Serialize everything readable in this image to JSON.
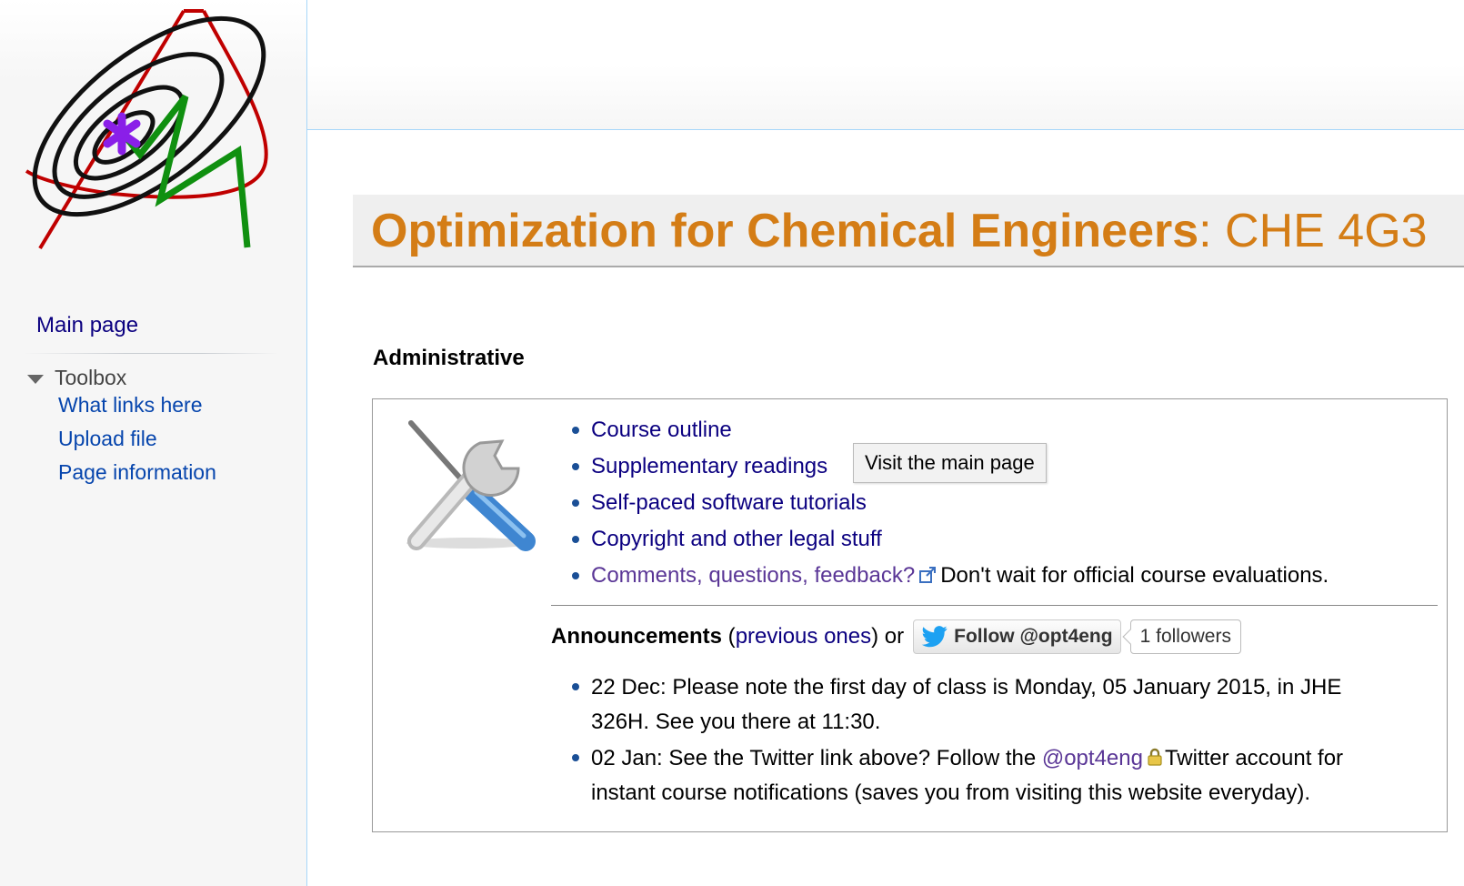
{
  "sidebar": {
    "main_page": "Main page",
    "toolbox": {
      "label": "Toolbox",
      "items": [
        {
          "label": "What links here"
        },
        {
          "label": "Upload file"
        },
        {
          "label": "Page information"
        }
      ]
    }
  },
  "page": {
    "title_bold": "Optimization for Chemical Engineers",
    "title_rest": ": CHE 4G3",
    "section_heading": "Administrative"
  },
  "admin_links": [
    {
      "label": "Course outline"
    },
    {
      "label": "Supplementary readings"
    },
    {
      "label": "Self-paced software tutorials"
    },
    {
      "label": "Copyright and other legal stuff"
    },
    {
      "label": "Comments, questions, feedback?",
      "suffix": "Don't wait for official course evaluations."
    }
  ],
  "tooltip": "Visit the main page",
  "announcements": {
    "heading": "Announcements",
    "open_paren": " (",
    "previous_label": "previous ones",
    "close_or": ") or",
    "follow_button": "Follow @opt4eng",
    "followers": "1 followers",
    "items": [
      {
        "text": "22 Dec: Please note the first day of class is Monday, 05 January 2015, in JHE 326H. See you there at 11:30."
      },
      {
        "before": "02 Jan: See the Twitter link above? Follow the ",
        "link": "@opt4eng",
        "after": "Twitter account for instant course notifications (saves you from visiting this website everyday)."
      }
    ]
  },
  "colors": {
    "title_orange": "#d47d16",
    "link_blue": "#0b0080",
    "visited_purple": "#5a3696",
    "twitter_blue": "#1da1f2"
  }
}
